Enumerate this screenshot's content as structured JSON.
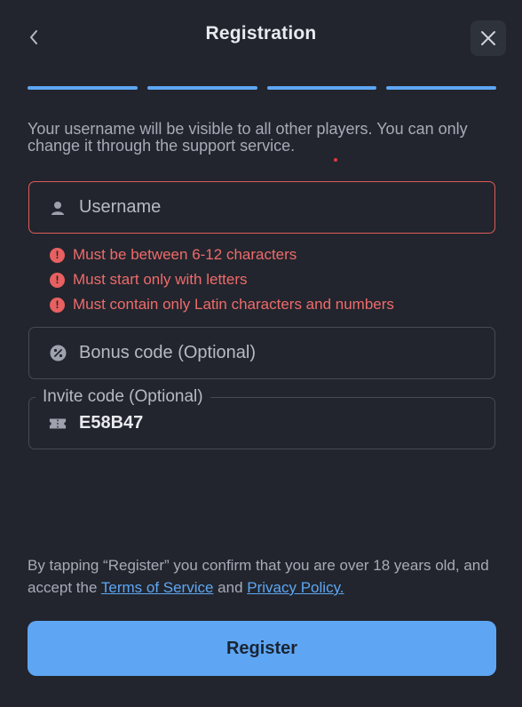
{
  "header": {
    "title": "Registration",
    "back_icon": "chevron-left-icon",
    "close_icon": "close-icon"
  },
  "progress": {
    "total_steps": 4,
    "completed_steps": 4,
    "color": "#5ea6f4"
  },
  "info_text": "Your username will be visible to all other players. You can only change it through the support service.",
  "username": {
    "placeholder": "Username",
    "value": "",
    "icon": "user-icon",
    "error_color": "#e05a5a",
    "errors": [
      "Must be between 6-12 characters",
      "Must start only with letters",
      "Must contain only Latin characters and numbers"
    ]
  },
  "bonus_code": {
    "placeholder": "Bonus code (Optional)",
    "value": "",
    "icon": "percent-badge-icon"
  },
  "invite_code": {
    "label": "Invite code (Optional)",
    "value": "E58B47",
    "icon": "ticket-icon"
  },
  "terms": {
    "prefix": "By tapping “Register” you confirm that you are over 18 years old, and accept the ",
    "tos_link": "Terms of Service",
    "middle": " and ",
    "privacy_link": "Privacy Policy."
  },
  "register_button": {
    "label": "Register",
    "color": "#5ea6f4"
  }
}
